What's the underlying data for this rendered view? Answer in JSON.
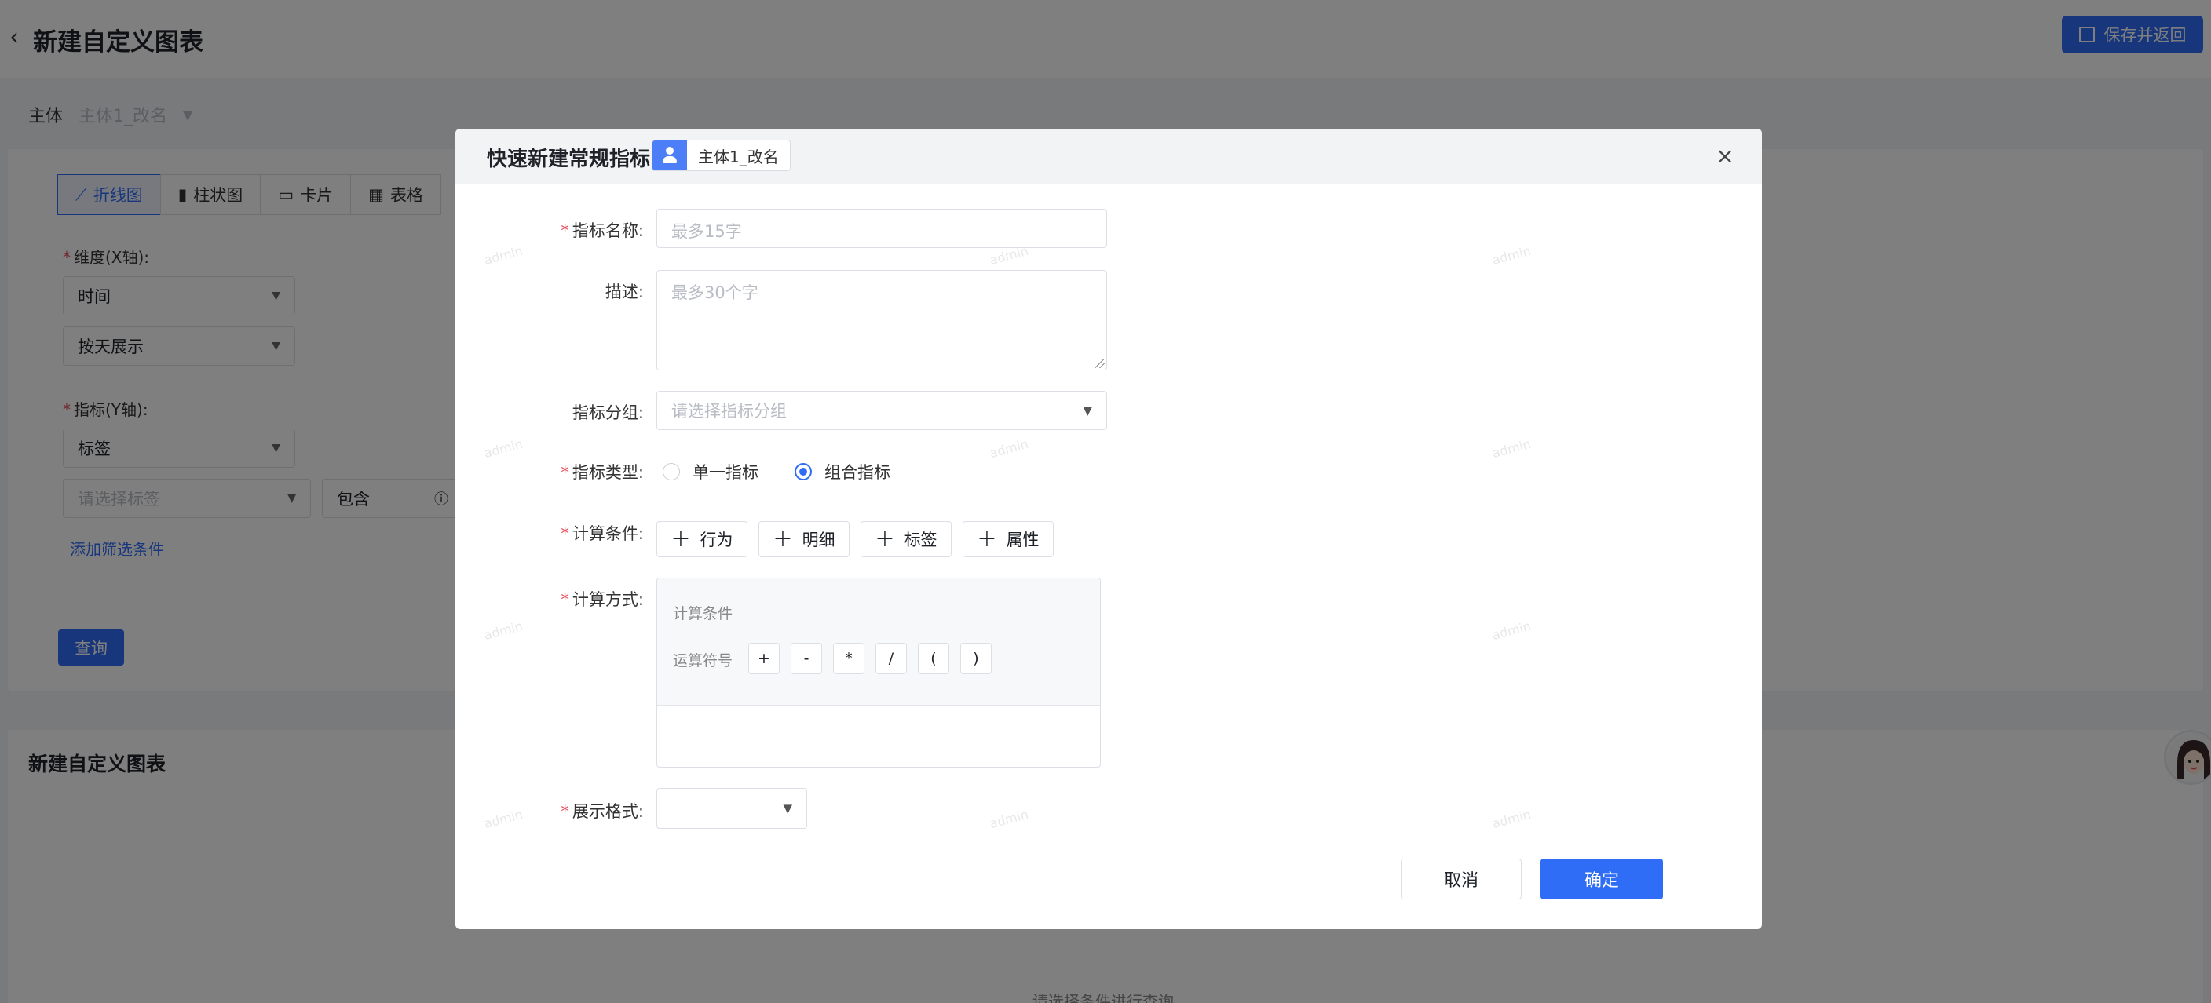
{
  "page": {
    "title": "新建自定义图表",
    "save_return_label": "保存并返回",
    "subject_label": "主体",
    "subject_value": "主体1_改名"
  },
  "chart_tabs": [
    "折线图",
    "柱状图",
    "卡片",
    "表格"
  ],
  "config": {
    "dimension_label": "维度(X轴):",
    "dimension_value": "时间",
    "dimension_granularity": "按天展示",
    "metric_label": "指标(Y轴):",
    "metric_value": "标签",
    "tag_placeholder": "请选择标签",
    "contains_label": "包含",
    "add_filter_label": "添加筛选条件",
    "query_label": "查询"
  },
  "preview": {
    "title": "新建自定义图表",
    "empty_text": "请选择条件进行查询"
  },
  "modal": {
    "title": "快速新建常规指标",
    "subject_chip": "主体1_改名",
    "watermark": "admin",
    "fields": {
      "name_label": "指标名称:",
      "name_placeholder": "最多15字",
      "desc_label": "描述:",
      "desc_placeholder": "最多30个字",
      "group_label": "指标分组:",
      "group_placeholder": "请选择指标分组",
      "type_label": "指标类型:",
      "type_options": [
        "单一指标",
        "组合指标"
      ],
      "type_selected": "组合指标",
      "cond_label": "计算条件:",
      "cond_buttons": [
        "行为",
        "明细",
        "标签",
        "属性"
      ],
      "method_label": "计算方式:",
      "calc_cond_text": "计算条件",
      "calc_op_text": "运算符号",
      "operators": [
        "+",
        "-",
        "*",
        "/",
        "(",
        ")"
      ],
      "format_label": "展示格式:"
    },
    "cancel_label": "取消",
    "ok_label": "确定"
  },
  "colors": {
    "primary": "#2f6df6",
    "required": "#e34d59",
    "overlay": "rgba(0,0,0,0.5)"
  }
}
